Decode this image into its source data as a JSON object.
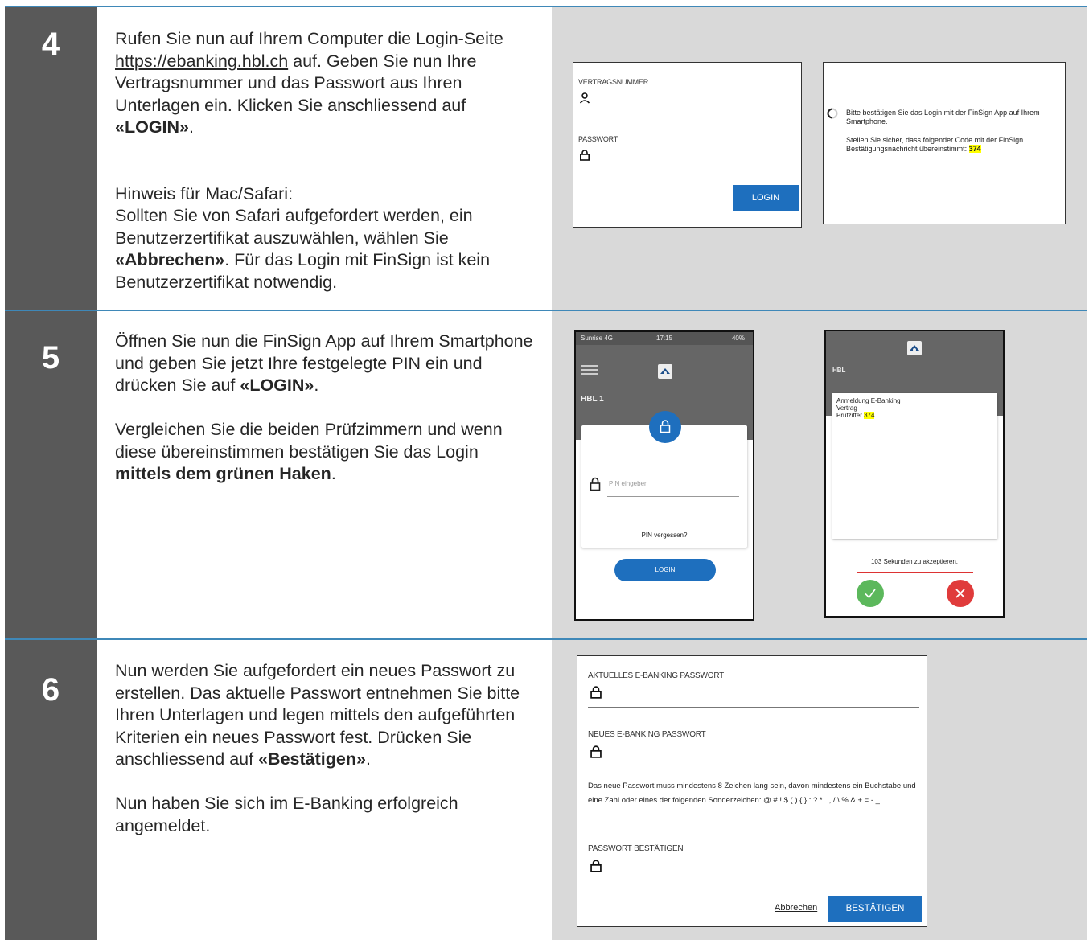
{
  "steps": [
    {
      "number": "4",
      "p1_a": "Rufen Sie nun auf Ihrem Computer die Login-Seite ",
      "p1_link": "https://ebanking.hbl.ch",
      "p1_b": " auf. Geben Sie nun Ihre Vertragsnummer und das Passwort aus Ihren Unterlagen ein. Klicken Sie anschliessend auf ",
      "p1_bold": "«LOGIN»",
      "p1_c": ".",
      "p2_line1": "Hinweis für Mac/Safari:",
      "p2_a": "Sollten Sie von Safari aufgefordert werden, ein Benutzerzertifikat auszuwählen, wählen Sie ",
      "p2_bold": "«Abbrechen»",
      "p2_b": ". Für das Login mit FinSign ist kein Benutzerzertifikat notwendig."
    },
    {
      "number": "5",
      "p1_a": "Öffnen Sie nun die FinSign App auf Ihrem Smartphone und geben Sie jetzt Ihre festgelegte PIN ein und drücken Sie auf ",
      "p1_bold": "«LOGIN»",
      "p1_b": ".",
      "p2_a": "Vergleichen Sie die beiden Prüfzimmern und wenn diese übereinstimmen bestätigen Sie das Login ",
      "p2_bold": "mittels dem grünen Haken",
      "p2_b": "."
    },
    {
      "number": "6",
      "p1_a": "Nun werden Sie aufgefordert ein neues Passwort zu erstellen. Das aktuelle Passwort entnehmen Sie bitte Ihren Unterlagen und legen mittels den aufgeführten Kriterien ein neues Passwort fest. Drücken Sie anschliessend auf ",
      "p1_bold": "«Bestätigen»",
      "p1_b": ".",
      "p2": "Nun haben Sie sich im E-Banking erfolgreich angemeldet."
    }
  ],
  "login_form": {
    "contract_label": "VERTRAGSNUMMER",
    "password_label": "PASSWORT",
    "login_button": "LOGIN"
  },
  "confirm_screen": {
    "line1": "Bitte bestätigen Sie das Login mit der FinSign App auf Ihrem Smartphone.",
    "line2": "Stellen Sie sicher, dass folgender Code mit der FinSign Bestätigungsnachricht übereinstimmt: ",
    "code": "374"
  },
  "phone_pin": {
    "status_carrier": "Sunrise 4G",
    "status_time": "17:15",
    "status_battery": "40%",
    "account": "HBL 1",
    "pin_placeholder": "PIN eingeben",
    "forgot": "PIN vergessen?",
    "login_button": "LOGIN"
  },
  "phone_confirm": {
    "account": "HBL",
    "msg_line1": "Anmeldung E-Banking",
    "msg_line2": "Vertrag",
    "msg_line3": "Prüfziffer",
    "code": "374",
    "countdown": "103 Sekunden zu akzeptieren."
  },
  "password_form": {
    "current_label": "AKTUELLES E-BANKING PASSWORT",
    "new_label": "NEUES E-BANKING PASSWORT",
    "rules": "Das neue Passwort muss mindestens 8 Zeichen lang sein, davon mindestens ein Buchstabe und eine Zahl oder eines der folgenden Sonderzeichen: @ # ! $ ( ) { } : ? * . , / \\ % & + = - _",
    "confirm_label": "PASSWORT BESTÄTIGEN",
    "cancel_link": "Abbrechen",
    "confirm_button": "BESTÄTIGEN"
  },
  "colors": {
    "rule_blue": "#3f88b8",
    "number_bg": "#595959",
    "image_bg": "#d9d9d9",
    "button_blue": "#1e6fbe",
    "highlight": "#ffff00",
    "accept_green": "#5cb85c",
    "reject_red": "#e03b3b"
  }
}
